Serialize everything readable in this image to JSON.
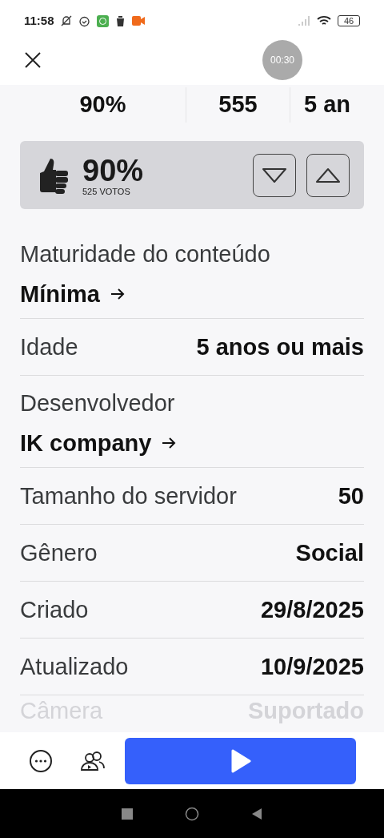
{
  "status_bar": {
    "time": "11:58",
    "battery": "46"
  },
  "header": {
    "recording_timer": "00:30"
  },
  "stats": [
    "90%",
    "555",
    "5 an"
  ],
  "rating": {
    "percent": "90%",
    "votes": "525 VOTOS"
  },
  "details": [
    {
      "kind": "stacked",
      "label": "Maturidade do conteúdo",
      "value": "Mínima",
      "link": true,
      "faded": false
    },
    {
      "kind": "inline",
      "label": "Idade",
      "value": "5 anos ou mais",
      "link": false,
      "faded": false
    },
    {
      "kind": "stacked",
      "label": "Desenvolvedor",
      "value": "IK company",
      "link": true,
      "faded": false
    },
    {
      "kind": "inline",
      "label": "Tamanho do servidor",
      "value": "50",
      "link": false,
      "faded": false
    },
    {
      "kind": "inline",
      "label": "Gênero",
      "value": "Social",
      "link": false,
      "faded": false
    },
    {
      "kind": "inline",
      "label": "Criado",
      "value": "29/8/2025",
      "link": false,
      "faded": false
    },
    {
      "kind": "inline",
      "label": "Atualizado",
      "value": "10/9/2025",
      "link": false,
      "faded": false
    },
    {
      "kind": "inline",
      "label": "Câmera",
      "value": "Suportado",
      "link": false,
      "faded": true
    }
  ]
}
